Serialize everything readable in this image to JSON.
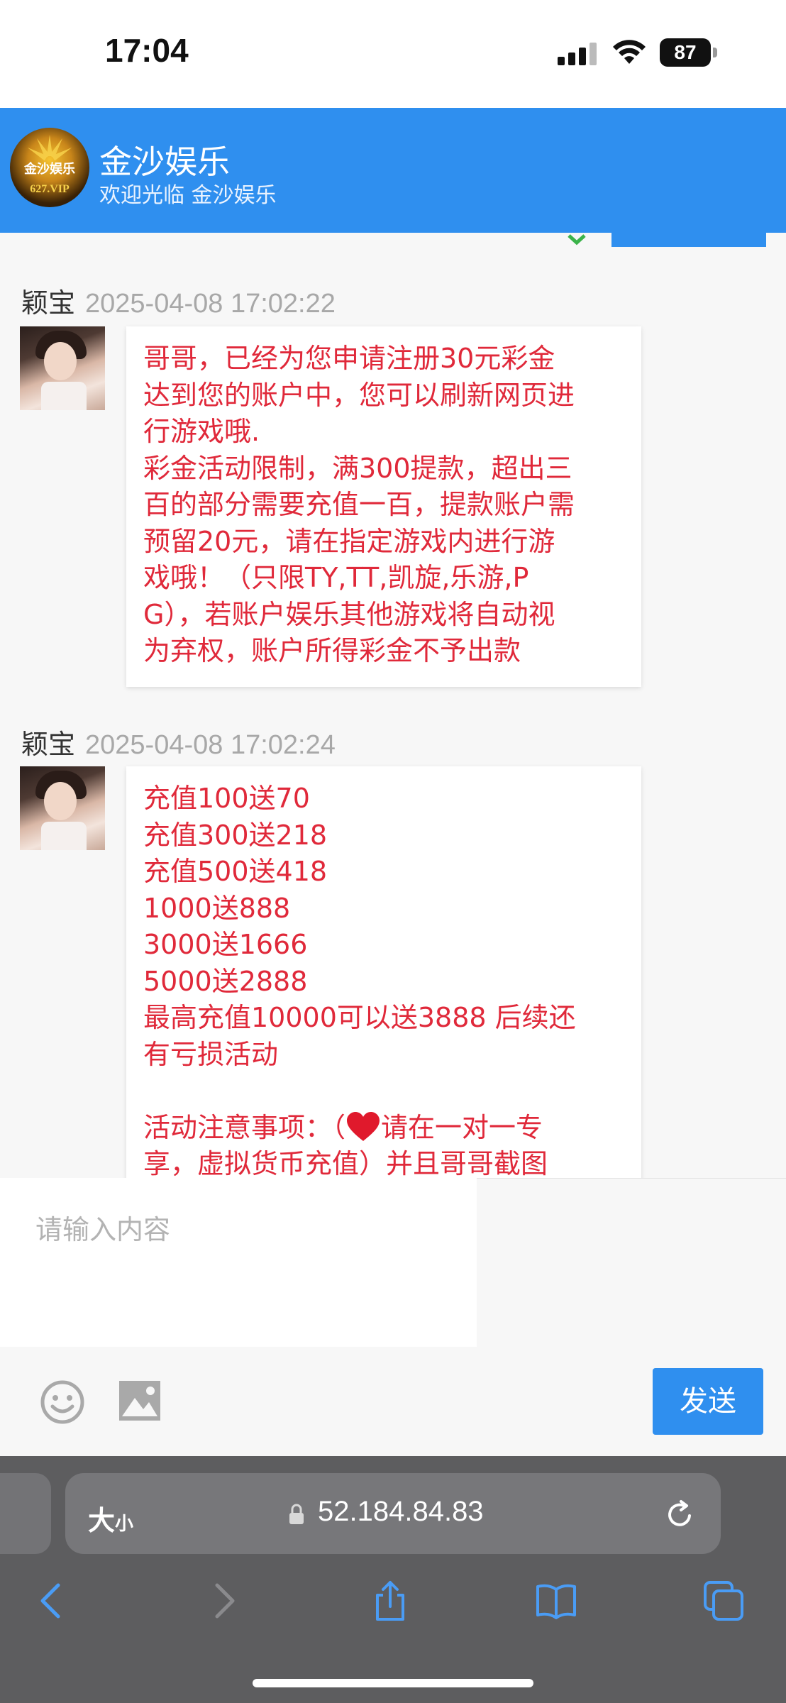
{
  "status_bar": {
    "time": "17:04",
    "battery": "87"
  },
  "header": {
    "logo_text": "金沙娱乐",
    "logo_sub": "627.VIP",
    "title": "金沙娱乐",
    "subtitle": "欢迎光临 金沙娱乐"
  },
  "messages": [
    {
      "sender": "颖宝",
      "time": "2025-04-08 17:02:22",
      "lines": [
        "哥哥，已经为您申请注册30元彩金",
        "达到您的账户中，您可以刷新网页进",
        "行游戏哦.",
        "彩金活动限制，满300提款，超出三",
        "百的部分需要充值一百，提款账户需",
        "预留20元，请在指定游戏内进行游",
        "戏哦！（只限TY,TT,凯旋,乐游,P",
        "G），若账户娱乐其他游戏将自动视",
        "为弃权，账户所得彩金不予出款"
      ]
    },
    {
      "sender": "颖宝",
      "time": "2025-04-08 17:02:24",
      "lines": [
        "充值100送70",
        "充值300送218",
        "充值500送418",
        "1000送888",
        "3000送1666",
        "5000送2888",
        "最高充值10000可以送3888 后续还",
        "有亏损活动",
        "",
        "活动注意事项：（",
        "请在一对一专",
        "享，虚拟货币充值）并且哥哥截图"
      ]
    }
  ],
  "input": {
    "placeholder": "请输入内容"
  },
  "toolbar": {
    "emoji_icon": "emoji-icon",
    "image_icon": "image-icon",
    "send_label": "发送"
  },
  "browser": {
    "aa_label": "大",
    "aa_small": "小",
    "url": "52.184.84.83"
  },
  "colors": {
    "accent": "#2f8fef",
    "message_text": "#e0293a"
  }
}
